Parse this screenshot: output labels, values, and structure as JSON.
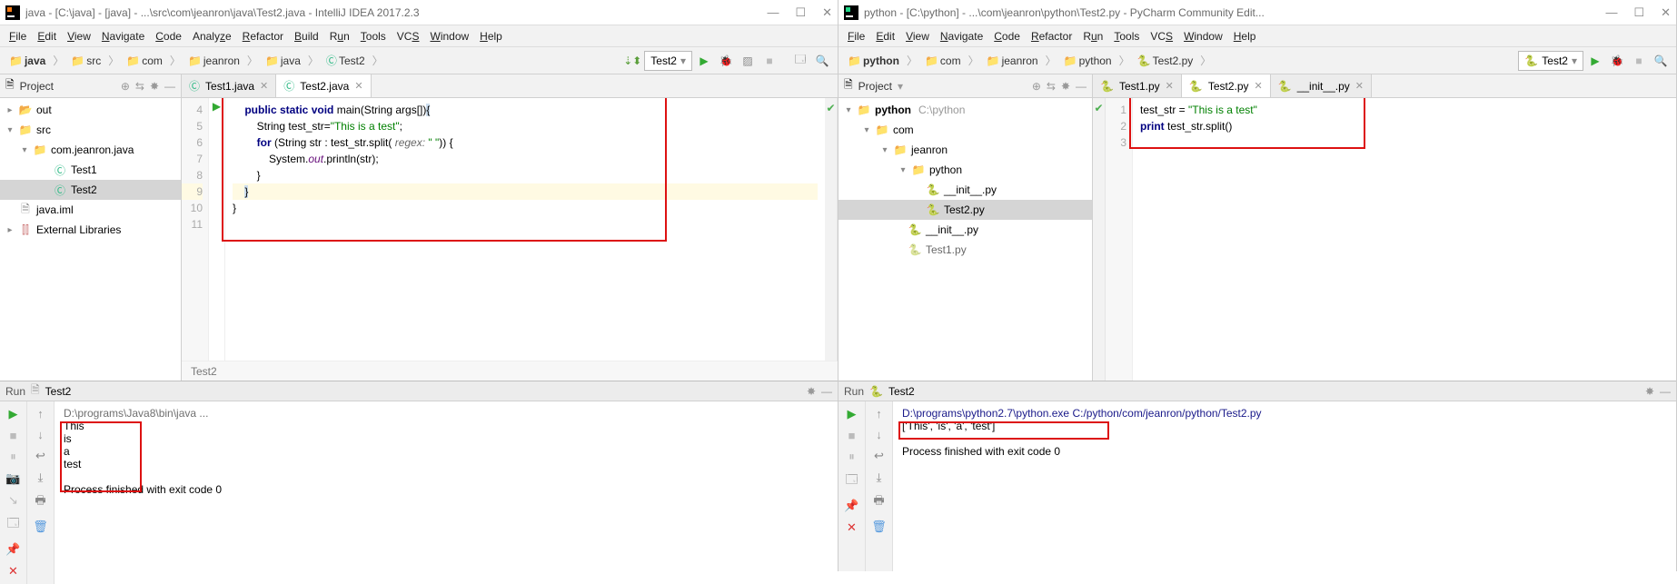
{
  "left": {
    "title": "java - [C:\\java] - [java] - ...\\src\\com\\jeanron\\java\\Test2.java - IntelliJ IDEA 2017.2.3",
    "menu": [
      "File",
      "Edit",
      "View",
      "Navigate",
      "Code",
      "Analyze",
      "Refactor",
      "Build",
      "Run",
      "Tools",
      "VCS",
      "Window",
      "Help"
    ],
    "crumbs": [
      "java",
      "src",
      "com",
      "jeanron",
      "java",
      "Test2"
    ],
    "runConfig": "Test2",
    "projectLabel": "Project",
    "tree": {
      "out": "out",
      "src": "src",
      "pkg": "com.jeanron.java",
      "test1": "Test1",
      "test2": "Test2",
      "iml": "java.iml",
      "ext": "External Libraries"
    },
    "tabs": {
      "t1": "Test1.java",
      "t2": "Test2.java"
    },
    "code": {
      "l4a": "public static void",
      "l4b": " main(String args[])",
      "l4c": "{",
      "l5a": "String test_str=",
      "l5b": "\"This is a test\"",
      "l5c": ";",
      "l6a": "for",
      "l6b": " (String str : test_str.split(",
      "l6c": " regex:",
      "l6d": " \" \"",
      "l6e": ")) {",
      "l7a": "System.",
      "l7b": "out",
      "l7c": ".println(str);",
      "l8": "}",
      "l9": "}",
      "l10": "}"
    },
    "breadcrumb2": "Test2",
    "runTab": "Run",
    "runTabName": "Test2",
    "console": {
      "cmd": "D:\\programs\\Java8\\bin\\java ...",
      "o1": "This",
      "o2": "is",
      "o3": "a",
      "o4": "test",
      "exit": "Process finished with exit code 0"
    }
  },
  "right": {
    "title": "python - [C:\\python] - ...\\com\\jeanron\\python\\Test2.py - PyCharm Community Edit...",
    "menu": [
      "File",
      "Edit",
      "View",
      "Navigate",
      "Code",
      "Refactor",
      "Run",
      "Tools",
      "VCS",
      "Window",
      "Help"
    ],
    "crumbs": [
      "python",
      "com",
      "jeanron",
      "python",
      "Test2.py"
    ],
    "runConfig": "Test2",
    "projectLabel": "Project",
    "tree": {
      "root": "python",
      "rootPath": "C:\\python",
      "com": "com",
      "jeanron": "jeanron",
      "pyfolder": "python",
      "init1": "__init__.py",
      "test2": "Test2.py",
      "init2": "__init__.py",
      "test1cut": "Test1.py"
    },
    "tabs": {
      "t1": "Test1.py",
      "t2": "Test2.py",
      "t3": "__init__.py"
    },
    "code": {
      "l1a": "test_str = ",
      "l1b": "\"This is a test\"",
      "l2a": "print",
      "l2b": " test_str.split()"
    },
    "runTab": "Run",
    "runTabName": "Test2",
    "console": {
      "cmd": "D:\\programs\\python2.7\\python.exe C:/python/com/jeanron/python/Test2.py",
      "o1": "['This', 'is', 'a', 'test']",
      "exit": "Process finished with exit code 0"
    }
  }
}
